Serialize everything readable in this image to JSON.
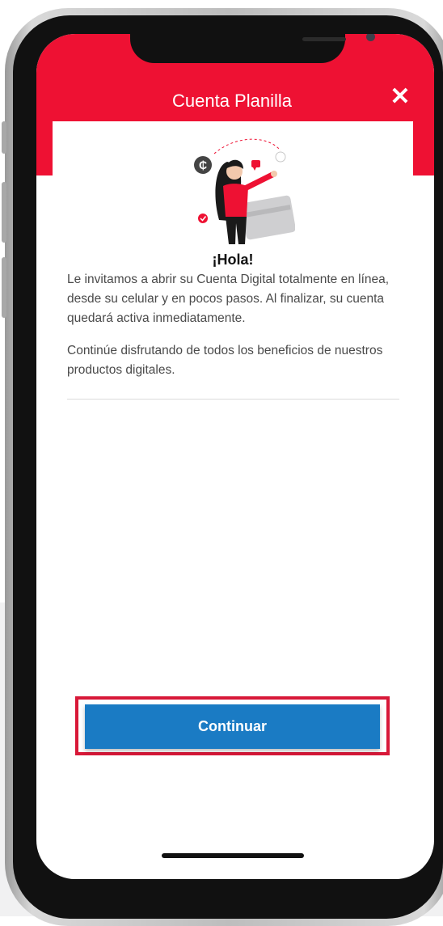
{
  "header": {
    "title": "Cuenta Planilla",
    "close_symbol": "✕",
    "bg_color": "#ee1133"
  },
  "content": {
    "greeting": "¡Hola!",
    "paragraph1": "Le invitamos a abrir su Cuenta Digital totalmente en línea, desde su celular y en pocos pasos. Al finalizar, su cuenta quedará activa inmediatamente.",
    "paragraph2": "Continúe disfrutando de todos los beneficios de nuestros productos digitales.",
    "illustration_icon": "woman-with-card-illustration"
  },
  "actions": {
    "continue_label": "Continuar",
    "button_color": "#1a7bc4",
    "highlight_color": "#d81838"
  }
}
